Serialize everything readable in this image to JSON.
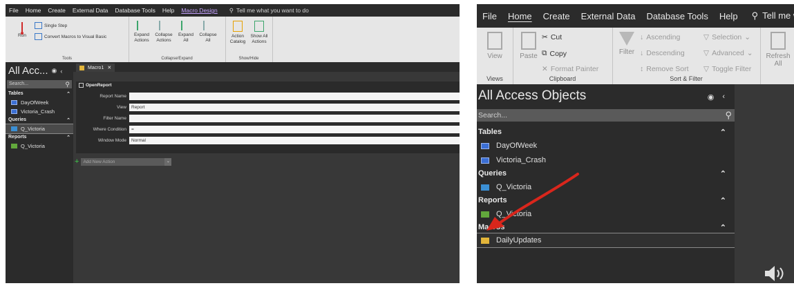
{
  "left": {
    "menu": [
      "File",
      "Home",
      "Create",
      "External Data",
      "Database Tools",
      "Help",
      "Macro Design"
    ],
    "tell_me": "Tell me what you want to do",
    "ribbon": {
      "run": "Run",
      "single_step": "Single Step",
      "convert": "Convert Macros to Visual Basic",
      "tools_label": "Tools",
      "expand_actions": "Expand Actions",
      "collapse_actions": "Collapse Actions",
      "expand_all": "Expand All",
      "collapse_all": "Collapse All",
      "collapse_expand_label": "Collapse/Expand",
      "action_catalog": "Action Catalog",
      "show_all_actions": "Show All Actions",
      "show_hide_label": "Show/Hide"
    },
    "nav": {
      "title": "All Acc...",
      "search_placeholder": "Search...",
      "groups": {
        "tables": "Tables",
        "queries": "Queries",
        "reports": "Reports"
      },
      "tables": [
        "DayOfWeek",
        "Victoria_Crash"
      ],
      "queries": [
        "Q_Victoria"
      ],
      "reports": [
        "Q_Victoria"
      ]
    },
    "doc_tab": "Macro1",
    "action": {
      "name": "OpenReport",
      "args": [
        {
          "label": "Report Name",
          "value": ""
        },
        {
          "label": "View",
          "value": "Report"
        },
        {
          "label": "Filter Name",
          "value": ""
        },
        {
          "label": "Where Condition",
          "value": "="
        },
        {
          "label": "Window Mode",
          "value": "Normal"
        }
      ]
    },
    "add_new_action": "Add New Action"
  },
  "right": {
    "menu": [
      "File",
      "Home",
      "Create",
      "External Data",
      "Database Tools",
      "Help"
    ],
    "tell_me": "Tell me wha",
    "ribbon": {
      "view": "View",
      "views_label": "Views",
      "paste": "Paste",
      "cut": "Cut",
      "copy": "Copy",
      "format_painter": "Format Painter",
      "clipboard_label": "Clipboard",
      "filter": "Filter",
      "ascending": "Ascending",
      "descending": "Descending",
      "remove_sort": "Remove Sort",
      "selection": "Selection",
      "advanced": "Advanced",
      "toggle_filter": "Toggle Filter",
      "sort_filter_label": "Sort & Filter",
      "refresh": "Refresh All"
    },
    "nav": {
      "title": "All Access Objects",
      "search_placeholder": "Search...",
      "groups": {
        "tables": "Tables",
        "queries": "Queries",
        "reports": "Reports",
        "macros": "Macros"
      },
      "tables": [
        "DayOfWeek",
        "Victoria_Crash"
      ],
      "queries": [
        "Q_Victoria"
      ],
      "reports": [
        "Q_Victoria"
      ],
      "macros": [
        "DailyUpdates"
      ]
    }
  },
  "colors": {
    "dark_bg": "#262626",
    "ribbon_bg": "#e6e6e6",
    "accent_purple": "#c5a2ff",
    "annotation_arrow": "#d9261c"
  }
}
